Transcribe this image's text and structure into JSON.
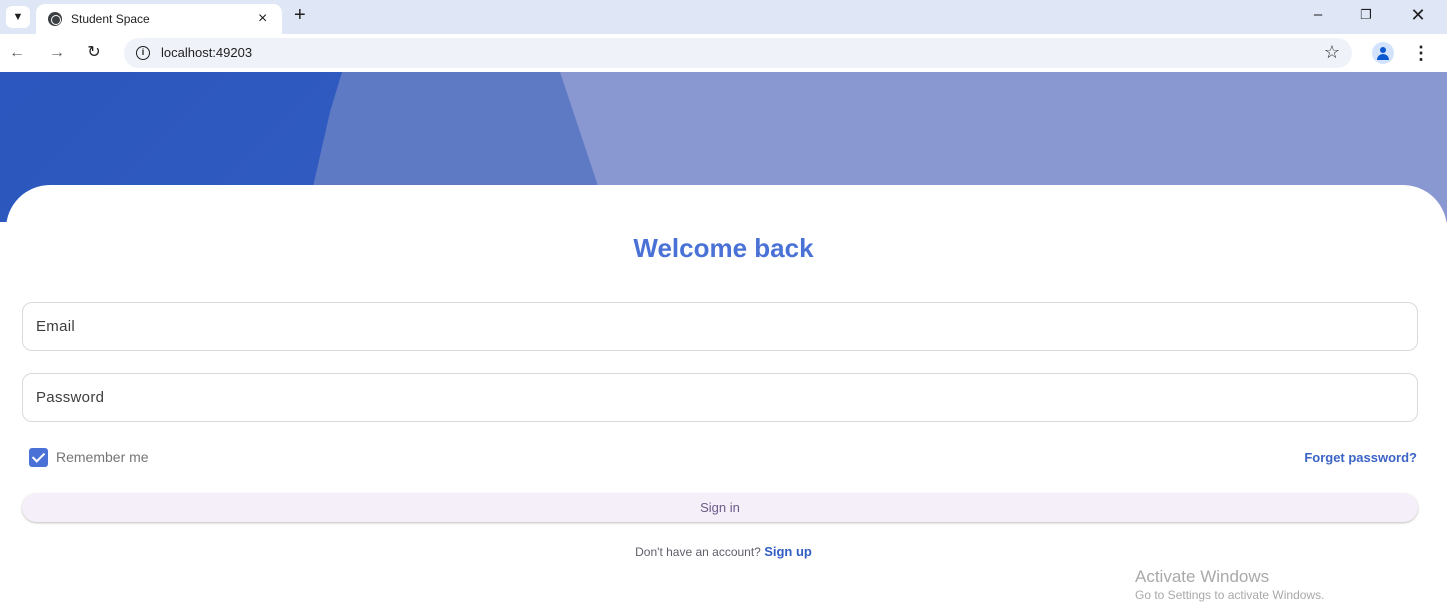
{
  "browser": {
    "tab_title": "Student Space",
    "tab_close": "×",
    "new_tab": "+",
    "url": "localhost:49203",
    "icons": {
      "tab_list": "chevron-down-icon",
      "favicon": "globe-icon",
      "back": "back-arrow-icon",
      "forward": "forward-arrow-icon",
      "reload": "reload-icon",
      "info": "info-icon",
      "bookmark": "star-icon",
      "profile": "profile-icon",
      "menu": "kebab-menu-icon"
    },
    "window_controls": {
      "minimize": "–",
      "restore": "❐",
      "close": "✕"
    }
  },
  "hero": {
    "colors": {
      "dark": "#2b57be",
      "mid": "#5e7ac4",
      "light": "#8a98d2"
    }
  },
  "login": {
    "title": "Welcome back",
    "email_placeholder": "Email",
    "password_placeholder": "Password",
    "remember_label": "Remember me",
    "remember_checked": true,
    "forgot_label": "Forget password?",
    "signin_label": "Sign in",
    "signup_prompt": "Don't have an account?",
    "signup_label": "Sign up",
    "accent_color": "#4a72d6"
  },
  "watermark": {
    "title": "Activate Windows",
    "subtitle": "Go to Settings to activate Windows."
  }
}
